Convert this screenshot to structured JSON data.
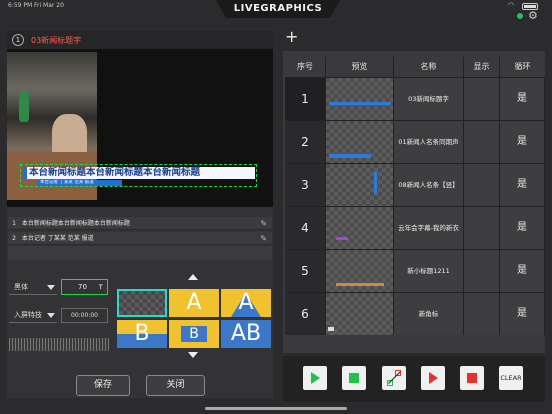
{
  "status_bar": {
    "time": "6:59 PM",
    "date": "Fri Mar 20"
  },
  "app": {
    "logo": "LIVEGRAPHICS"
  },
  "preview": {
    "number": "1",
    "title": "03新闻标题字",
    "overlay_main": "本台新闻标题本台新闻标题本台新闻标题",
    "overlay_sub": "本台记者 丁某某 范某 报道"
  },
  "text_rows": [
    {
      "num": "1",
      "text": "本台新闻标题本台新闻标题本台新闻标题"
    },
    {
      "num": "2",
      "text": "本台记者 丁某某 范某 报道"
    }
  ],
  "controls": {
    "font": "黑体",
    "font_size": "70",
    "effect": "入屏特技",
    "timecode": "00:00:00"
  },
  "templates": [
    {
      "glyph": ""
    },
    {
      "glyph": "A"
    },
    {
      "glyph": "A"
    },
    {
      "glyph": "B"
    },
    {
      "glyph": "B"
    },
    {
      "glyph": "AB"
    }
  ],
  "buttons": {
    "save": "保存",
    "close": "关闭",
    "clear": "CLEAR"
  },
  "table": {
    "headers": [
      "序号",
      "预览",
      "名称",
      "显示",
      "循环"
    ],
    "rows": [
      {
        "seq": "1",
        "name": "03新闻标题字",
        "display": "",
        "loop": "是"
      },
      {
        "seq": "2",
        "name": "01新闻人名条同期声",
        "display": "",
        "loop": "是"
      },
      {
        "seq": "3",
        "name": "08新闻人名条【竖】",
        "display": "",
        "loop": "是"
      },
      {
        "seq": "4",
        "name": "云年会字幕-我的新衣",
        "display": "",
        "loop": "是"
      },
      {
        "seq": "5",
        "name": "新小标题1211",
        "display": "",
        "loop": "是"
      },
      {
        "seq": "6",
        "name": "新角标",
        "display": "",
        "loop": "是"
      }
    ]
  },
  "colors": {
    "accent_green": "#1ed84a",
    "title_red": "#ff5a4f",
    "stop_red": "#e23232",
    "template_yellow": "#f0c230",
    "template_blue": "#3d78c8"
  },
  "icons": [
    "wifi-icon",
    "battery-icon",
    "gear-icon",
    "plus-icon",
    "pencil-icon",
    "play-icon",
    "stop-icon",
    "swap-icon"
  ]
}
